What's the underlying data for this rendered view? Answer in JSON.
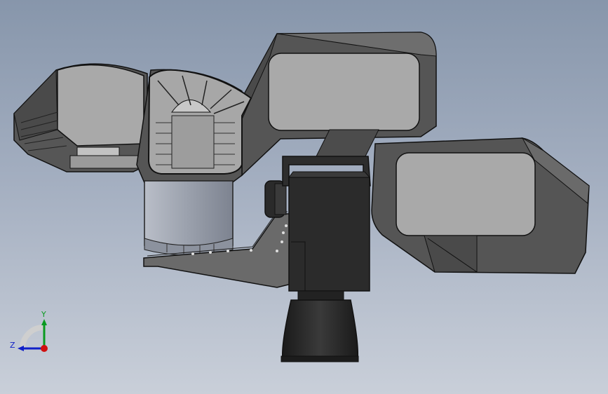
{
  "viewport": {
    "background_top": "#8796ab",
    "background_bottom": "#c9cfd9"
  },
  "triad": {
    "x_axis_color": "#d01010",
    "y_axis_color": "#0a9a20",
    "z_axis_color": "#1020c8",
    "y_label": "Y",
    "z_label": "Z"
  },
  "model": {
    "body_color": "#555555",
    "panel_color": "#a6a6a6",
    "dark_color": "#2b2b2b",
    "cylinder_color": "#9aa0ac",
    "bracket_color": "#777777"
  }
}
